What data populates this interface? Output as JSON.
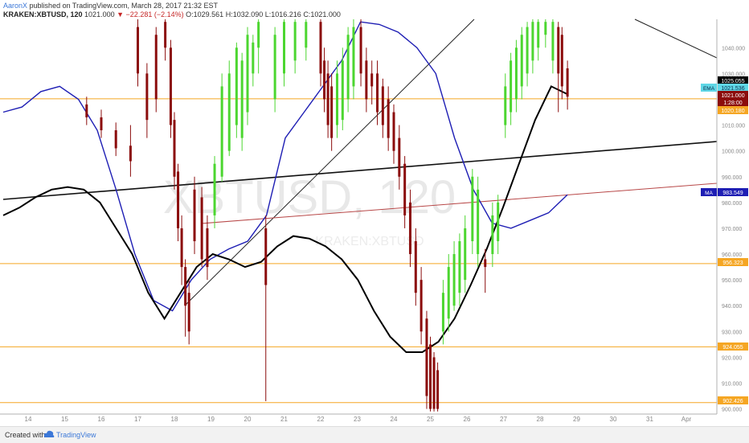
{
  "header": {
    "author": "AaronX",
    "published_text": "published on TradingView.com, March 28, 2017 21:32 EST",
    "symbol": "KRAKEN:XBTUSD, 120",
    "last": "1021.000",
    "change": "−22.281 (−2.14%)",
    "open": "O:1029.561",
    "high": "H:1032.090",
    "low": "L:1016.216",
    "close": "C:1021.000"
  },
  "watermark": {
    "symbol": "XBTUSD, 120",
    "sub": "KRAKEN:XBTUSD"
  },
  "footer": {
    "created_with": "Created with",
    "brand": "TradingView"
  },
  "colors": {
    "up": "#4cd630",
    "down": "#8b0c0c",
    "ema": "#000000",
    "ma": "#1e1eb4",
    "level": "#f5a623",
    "sma": "#a8831f"
  },
  "chart_data": {
    "type": "candlestick",
    "ylim": [
      898,
      1051
    ],
    "y_ticks": [
      900,
      910,
      920,
      930,
      940,
      950,
      960,
      970,
      980,
      990,
      1000,
      1010,
      1020,
      1030,
      1040
    ],
    "x_ticks": [
      "14",
      "15",
      "16",
      "17",
      "18",
      "19",
      "20",
      "21",
      "22",
      "23",
      "24",
      "25",
      "26",
      "27",
      "28",
      "29",
      "30",
      "31",
      "Apr"
    ],
    "badges": [
      {
        "label": "",
        "value": "1025.055"
      },
      {
        "label": "EMA",
        "value": "1021.536"
      },
      {
        "label": "",
        "value": "1021.000"
      },
      {
        "label": "",
        "value": "1:28:00"
      },
      {
        "label": "",
        "value": "1020.180"
      },
      {
        "label": "MA",
        "value": "983.549"
      },
      {
        "label": "",
        "value": "956.323"
      },
      {
        "label": "",
        "value": "924.055"
      },
      {
        "label": "",
        "value": "902.426"
      }
    ],
    "labels": {
      "ema": "EMA",
      "ma": "MA"
    },
    "levels": [
      1020.18,
      956.323,
      924.055,
      902.426
    ],
    "ema": [
      975,
      978,
      982,
      985,
      986,
      985,
      980,
      970,
      960,
      945,
      935,
      945,
      955,
      960,
      958,
      955,
      957,
      963,
      967,
      966,
      963,
      958,
      950,
      938,
      928,
      922,
      922,
      926,
      935,
      948,
      962,
      978,
      995,
      1012,
      1025,
      1022
    ],
    "ma": [
      1015,
      1017,
      1023,
      1025,
      1020,
      1008,
      985,
      960,
      942,
      938,
      950,
      958,
      962,
      965,
      975,
      1005,
      1015,
      1025,
      1035,
      1050,
      1049,
      1046,
      1040,
      1030,
      1005,
      985,
      972,
      970,
      973,
      976,
      983
    ],
    "candles": [
      {
        "x": 15.6,
        "o": 1018,
        "c": 1013,
        "h": 1021,
        "l": 1010
      },
      {
        "x": 16.0,
        "o": 1013,
        "c": 1008,
        "h": 1016,
        "l": 1005
      },
      {
        "x": 16.4,
        "o": 1008,
        "c": 1001,
        "h": 1011,
        "l": 998
      },
      {
        "x": 16.8,
        "o": 1002,
        "c": 996,
        "h": 1010,
        "l": 990
      },
      {
        "x": 17.0,
        "o": 1048,
        "c": 1030,
        "h": 1051,
        "l": 1025
      },
      {
        "x": 17.25,
        "o": 1030,
        "c": 1012,
        "h": 1034,
        "l": 1005
      },
      {
        "x": 17.5,
        "o": 1045,
        "c": 1020,
        "h": 1048,
        "l": 1015
      },
      {
        "x": 17.75,
        "o": 1050,
        "c": 1040,
        "h": 1051,
        "l": 1035
      },
      {
        "x": 17.9,
        "o": 1040,
        "c": 1010,
        "h": 1043,
        "l": 1005
      },
      {
        "x": 18.0,
        "o": 1012,
        "c": 990,
        "h": 1015,
        "l": 985
      },
      {
        "x": 18.1,
        "o": 992,
        "c": 970,
        "h": 995,
        "l": 965
      },
      {
        "x": 18.2,
        "o": 970,
        "c": 955,
        "h": 975,
        "l": 948
      },
      {
        "x": 18.3,
        "o": 955,
        "c": 940,
        "h": 958,
        "l": 928
      },
      {
        "x": 18.4,
        "o": 945,
        "c": 930,
        "h": 950,
        "l": 925
      },
      {
        "x": 18.55,
        "o": 985,
        "c": 965,
        "h": 990,
        "l": 960
      },
      {
        "x": 18.75,
        "o": 982,
        "c": 958,
        "h": 986,
        "l": 955
      },
      {
        "x": 18.9,
        "o": 970,
        "c": 955,
        "h": 975,
        "l": 950
      },
      {
        "x": 19.1,
        "o": 975,
        "c": 995,
        "h": 998,
        "l": 970
      },
      {
        "x": 19.3,
        "o": 990,
        "c": 1025,
        "h": 1030,
        "l": 988
      },
      {
        "x": 19.5,
        "o": 1000,
        "c": 1030,
        "h": 1035,
        "l": 998
      },
      {
        "x": 19.7,
        "o": 1010,
        "c": 1040,
        "h": 1042,
        "l": 1005
      },
      {
        "x": 19.85,
        "o": 1005,
        "c": 1035,
        "h": 1038,
        "l": 1000
      },
      {
        "x": 20.0,
        "o": 1015,
        "c": 1045,
        "h": 1048,
        "l": 1010
      },
      {
        "x": 20.15,
        "o": 1030,
        "c": 1042,
        "h": 1045,
        "l": 1025
      },
      {
        "x": 20.3,
        "o": 1040,
        "c": 1050,
        "h": 1051,
        "l": 1030
      },
      {
        "x": 20.5,
        "o": 970,
        "c": 948,
        "h": 975,
        "l": 903
      },
      {
        "x": 20.75,
        "o": 1020,
        "c": 1045,
        "h": 1048,
        "l": 1015
      },
      {
        "x": 21.0,
        "o": 1030,
        "c": 1050,
        "h": 1051,
        "l": 1025
      },
      {
        "x": 21.3,
        "o": 1035,
        "c": 1050,
        "h": 1051,
        "l": 1030
      },
      {
        "x": 21.6,
        "o": 1040,
        "c": 1050,
        "h": 1051,
        "l": 1035
      },
      {
        "x": 22.0,
        "o": 1050,
        "c": 1030,
        "h": 1051,
        "l": 1025
      },
      {
        "x": 22.1,
        "o": 1035,
        "c": 1020,
        "h": 1040,
        "l": 1015
      },
      {
        "x": 22.2,
        "o": 1030,
        "c": 1010,
        "h": 1035,
        "l": 1005
      },
      {
        "x": 22.3,
        "o": 1025,
        "c": 1005,
        "h": 1030,
        "l": 1000
      },
      {
        "x": 22.45,
        "o": 1010,
        "c": 1030,
        "h": 1035,
        "l": 1005
      },
      {
        "x": 22.6,
        "o": 1012,
        "c": 1035,
        "h": 1040,
        "l": 1008
      },
      {
        "x": 22.75,
        "o": 1020,
        "c": 1045,
        "h": 1048,
        "l": 1015
      },
      {
        "x": 22.9,
        "o": 1025,
        "c": 1048,
        "h": 1051,
        "l": 1020
      },
      {
        "x": 23.1,
        "o": 1048,
        "c": 1030,
        "h": 1051,
        "l": 1025
      },
      {
        "x": 23.25,
        "o": 1035,
        "c": 1020,
        "h": 1040,
        "l": 1015
      },
      {
        "x": 23.4,
        "o": 1030,
        "c": 1025,
        "h": 1035,
        "l": 1018
      },
      {
        "x": 23.55,
        "o": 1030,
        "c": 1015,
        "h": 1035,
        "l": 1010
      },
      {
        "x": 23.7,
        "o": 1025,
        "c": 1010,
        "h": 1028,
        "l": 1005
      },
      {
        "x": 23.85,
        "o": 1020,
        "c": 1005,
        "h": 1025,
        "l": 1000
      },
      {
        "x": 24.0,
        "o": 1015,
        "c": 1000,
        "h": 1018,
        "l": 995
      },
      {
        "x": 24.15,
        "o": 1005,
        "c": 990,
        "h": 1010,
        "l": 985
      },
      {
        "x": 24.3,
        "o": 995,
        "c": 975,
        "h": 998,
        "l": 970
      },
      {
        "x": 24.45,
        "o": 980,
        "c": 960,
        "h": 985,
        "l": 955
      },
      {
        "x": 24.6,
        "o": 965,
        "c": 945,
        "h": 970,
        "l": 940
      },
      {
        "x": 24.75,
        "o": 950,
        "c": 930,
        "h": 955,
        "l": 925
      },
      {
        "x": 24.9,
        "o": 935,
        "c": 905,
        "h": 938,
        "l": 900
      },
      {
        "x": 25.0,
        "o": 925,
        "c": 900,
        "h": 928,
        "l": 899
      },
      {
        "x": 25.1,
        "o": 920,
        "c": 900,
        "h": 922,
        "l": 899
      },
      {
        "x": 25.2,
        "o": 915,
        "c": 900,
        "h": 918,
        "l": 899
      },
      {
        "x": 25.35,
        "o": 930,
        "c": 945,
        "h": 950,
        "l": 925
      },
      {
        "x": 25.5,
        "o": 935,
        "c": 955,
        "h": 960,
        "l": 930
      },
      {
        "x": 25.65,
        "o": 940,
        "c": 960,
        "h": 965,
        "l": 938
      },
      {
        "x": 25.8,
        "o": 945,
        "c": 965,
        "h": 968,
        "l": 940
      },
      {
        "x": 25.95,
        "o": 950,
        "c": 970,
        "h": 975,
        "l": 945
      },
      {
        "x": 26.15,
        "o": 965,
        "c": 990,
        "h": 993,
        "l": 960
      },
      {
        "x": 26.3,
        "o": 960,
        "c": 985,
        "h": 990,
        "l": 955
      },
      {
        "x": 26.5,
        "o": 958,
        "c": 955,
        "h": 962,
        "l": 945
      },
      {
        "x": 26.7,
        "o": 960,
        "c": 975,
        "h": 980,
        "l": 955
      },
      {
        "x": 26.85,
        "o": 965,
        "c": 980,
        "h": 983,
        "l": 960
      },
      {
        "x": 27.05,
        "o": 1010,
        "c": 1025,
        "h": 1030,
        "l": 1005
      },
      {
        "x": 27.2,
        "o": 1015,
        "c": 1035,
        "h": 1038,
        "l": 1010
      },
      {
        "x": 27.35,
        "o": 1020,
        "c": 1040,
        "h": 1043,
        "l": 1015
      },
      {
        "x": 27.5,
        "o": 1025,
        "c": 1045,
        "h": 1048,
        "l": 1020
      },
      {
        "x": 27.65,
        "o": 1030,
        "c": 1048,
        "h": 1050,
        "l": 1025
      },
      {
        "x": 27.8,
        "o": 1035,
        "c": 1050,
        "h": 1051,
        "l": 1030
      },
      {
        "x": 27.95,
        "o": 1040,
        "c": 1050,
        "h": 1051,
        "l": 1035
      },
      {
        "x": 28.15,
        "o": 1045,
        "c": 1050,
        "h": 1051,
        "l": 1040
      },
      {
        "x": 28.35,
        "o": 1035,
        "c": 1050,
        "h": 1051,
        "l": 1030
      },
      {
        "x": 28.5,
        "o": 1048,
        "c": 1030,
        "h": 1050,
        "l": 1015
      },
      {
        "x": 28.6,
        "o": 1045,
        "c": 1025,
        "h": 1048,
        "l": 1020
      },
      {
        "x": 28.75,
        "o": 1032,
        "c": 1021,
        "h": 1035,
        "l": 1016
      }
    ]
  }
}
